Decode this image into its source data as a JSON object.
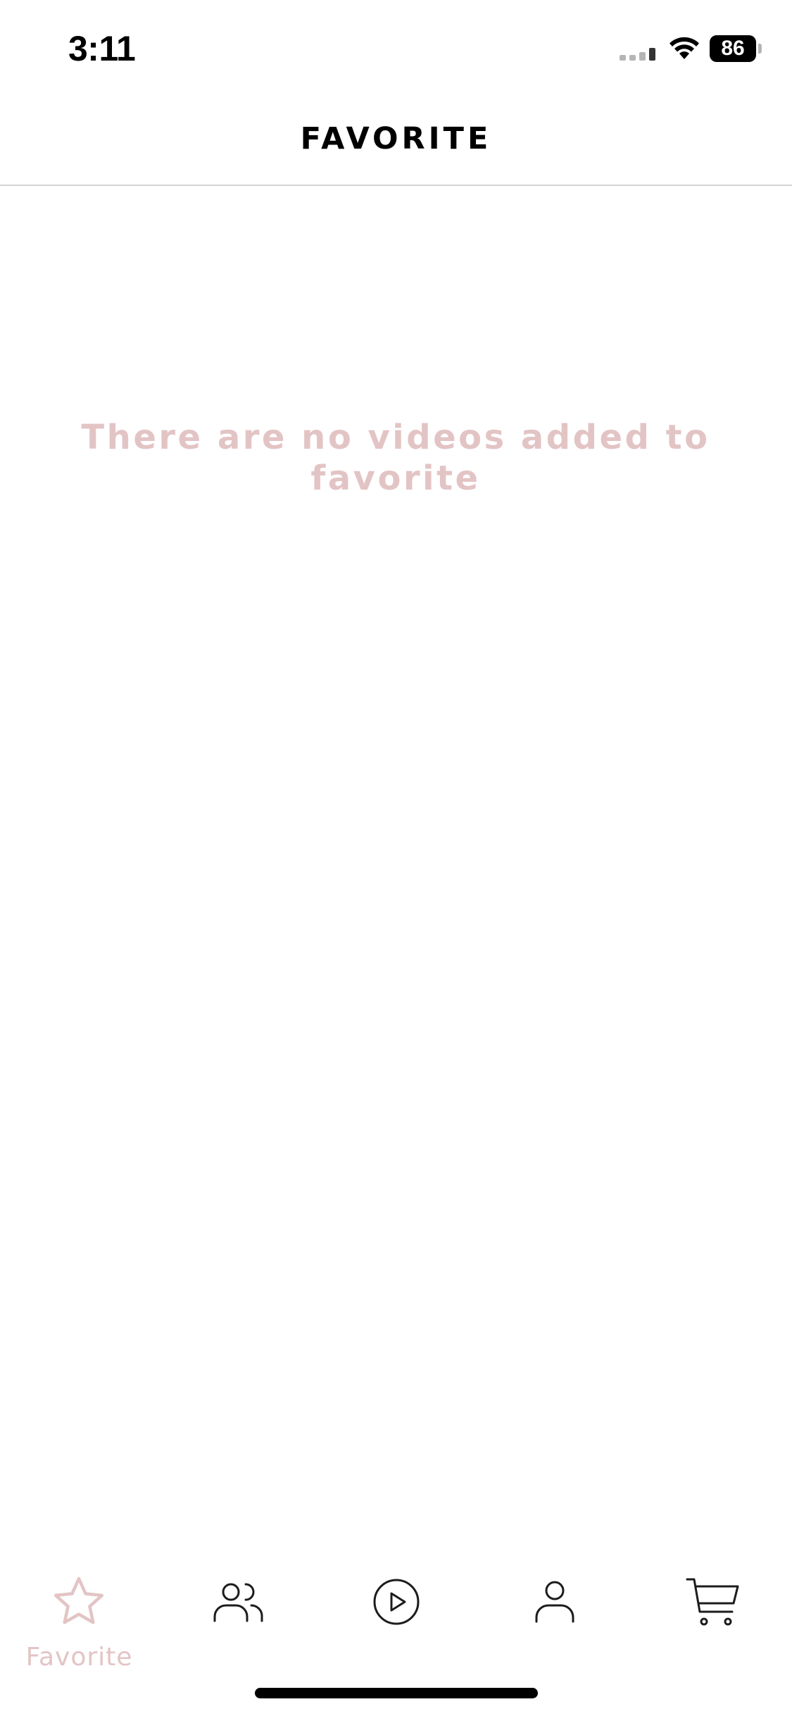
{
  "status_bar": {
    "time": "3:11",
    "battery_level": "86",
    "signal_icon": "cellular-signal-icon",
    "wifi_icon": "wifi-icon"
  },
  "header": {
    "title": "FAVORITE"
  },
  "empty_state": {
    "message": "There are no videos added to favorite"
  },
  "tab_bar": {
    "tabs": [
      {
        "label": "Favorite",
        "icon": "star-icon",
        "active": true
      },
      {
        "label": "",
        "icon": "users-icon",
        "active": false
      },
      {
        "label": "",
        "icon": "play-circle-icon",
        "active": false
      },
      {
        "label": "",
        "icon": "user-icon",
        "active": false
      },
      {
        "label": "",
        "icon": "cart-icon",
        "active": false
      }
    ]
  },
  "colors": {
    "accent": "#e3c4c5",
    "text": "#000000",
    "icon": "#1c1c1c",
    "divider": "#d4d4d4"
  }
}
